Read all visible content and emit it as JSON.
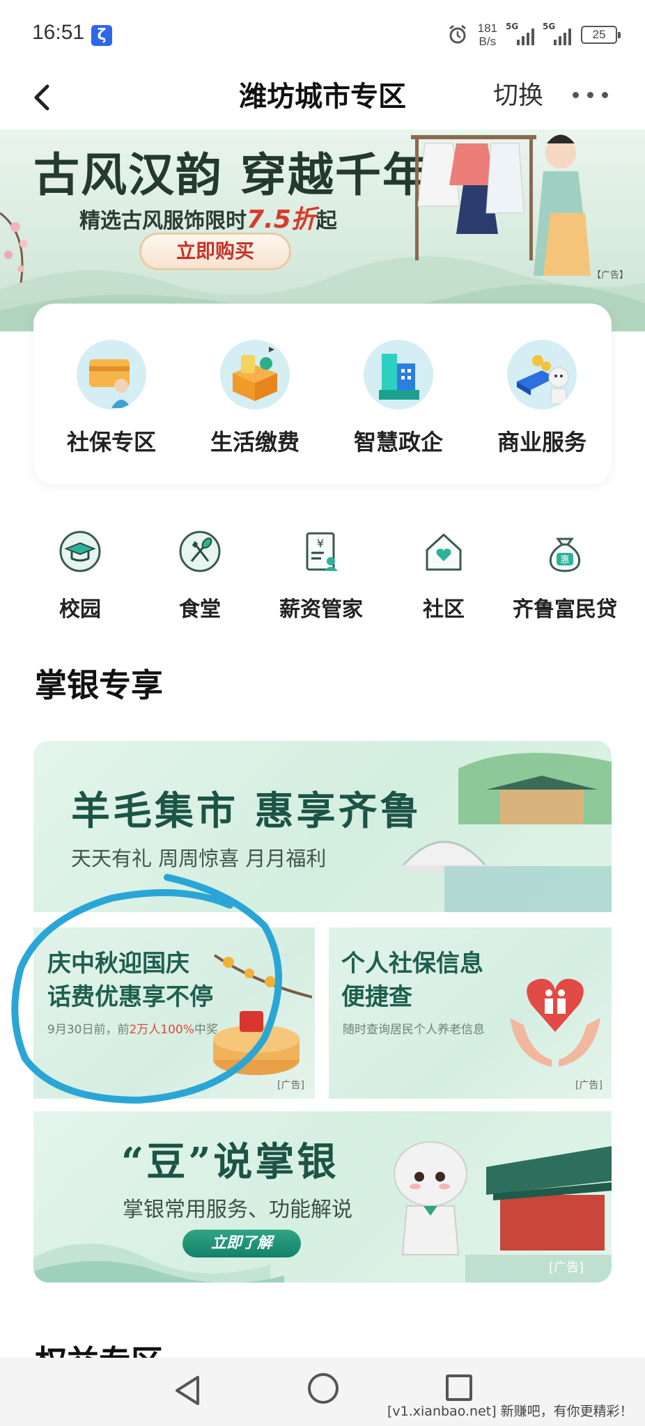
{
  "status_bar": {
    "time": "16:51",
    "net_speed_value": "181",
    "net_speed_unit": "B/s",
    "sim1_tag": "5G",
    "sim2_tag": "5G",
    "battery": "25"
  },
  "nav": {
    "title": "潍坊城市专区",
    "switch_label": "切换"
  },
  "hero": {
    "title": "古风汉韵 穿越千年",
    "subtitle_prefix": "精选古风服饰限时",
    "subtitle_highlight": "7.5折",
    "subtitle_suffix": "起",
    "button": "立即购买",
    "ad_tag": "【广告】"
  },
  "quick_services": [
    {
      "label": "社保专区",
      "icon": "social-security-card-icon"
    },
    {
      "label": "生活缴费",
      "icon": "life-payment-box-icon"
    },
    {
      "label": "智慧政企",
      "icon": "smart-gov-building-icon"
    },
    {
      "label": "商业服务",
      "icon": "business-service-icon"
    }
  ],
  "secondary_services": [
    {
      "label": "校园",
      "icon": "graduation-cap-icon"
    },
    {
      "label": "食堂",
      "icon": "fork-spoon-icon"
    },
    {
      "label": "薪资管家",
      "icon": "salary-document-icon"
    },
    {
      "label": "社区",
      "icon": "community-house-icon"
    },
    {
      "label": "齐鲁富民贷",
      "icon": "money-bag-icon"
    }
  ],
  "section_title": "掌银专享",
  "promos": {
    "big": {
      "title": "羊毛集市 惠享齐鲁",
      "subtitle": "天天有礼 周周惊喜 月月福利"
    },
    "left": {
      "line1": "庆中秋迎国庆",
      "line2": "话费优惠享不停",
      "desc_prefix": "9月30日前，前",
      "desc_highlight": "2万人100%",
      "desc_suffix": "中奖",
      "ad_tag": "[广告]"
    },
    "right": {
      "line1": "个人社保信息",
      "line2": "便捷查",
      "desc": "随时查询居民个人养老信息",
      "ad_tag": "[广告]"
    },
    "bottom": {
      "title": "“豆”说掌银",
      "subtitle": "掌银常用服务、功能解说",
      "button": "立即了解",
      "ad_tag": "[广告]"
    }
  },
  "next_section_title": "权益专区",
  "watermark": "[v1.xianbao.net] 新赚吧，有你更精彩！",
  "colors": {
    "brand_green": "#1c5446",
    "accent_red": "#d83b2f",
    "annotation_blue": "#2aa6d6"
  }
}
